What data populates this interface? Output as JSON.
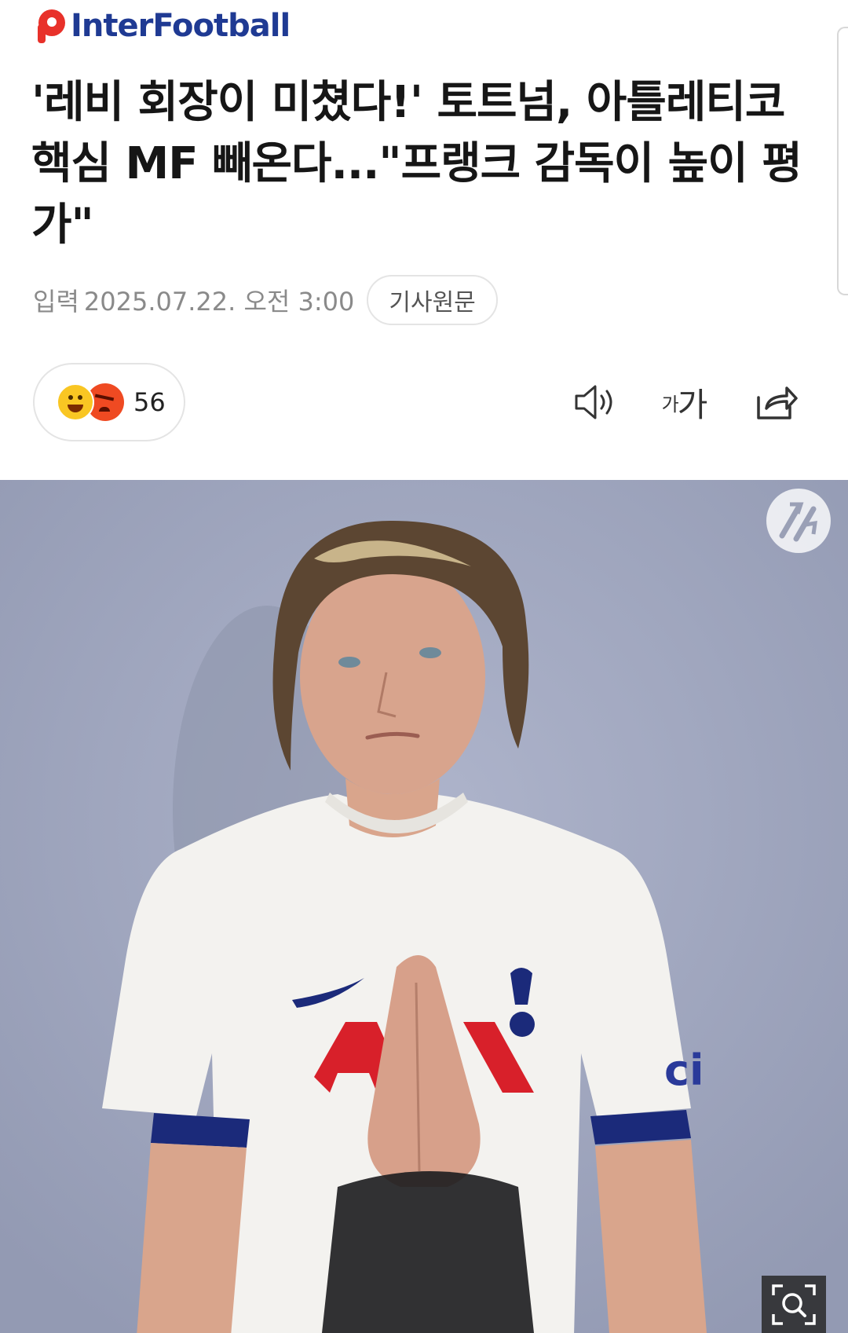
{
  "header": {
    "logo_text": "InterFootball",
    "brand_color": "#1f3a93",
    "accent_color": "#e8312a"
  },
  "article": {
    "headline": "'레비 회장이 미쳤다!' 토트넘, 아틀레티코 핵심 MF 빼온다...\"프랭크 감독이 높이 평가\"",
    "published_label": "입력",
    "published_date": "2025.07.22. 오전 3:00",
    "original_article_button": "기사원문"
  },
  "reactions": {
    "count": "56",
    "emojis": [
      "happy-face-icon",
      "angry-face-icon"
    ]
  },
  "toolbar": {
    "speaker_icon": "speaker-icon",
    "font_small_glyph": "가",
    "font_large_glyph": "가",
    "share_icon": "share-icon"
  },
  "photo": {
    "watermark_icon": "interfootball-watermark-icon",
    "zoom_icon": "zoom-search-icon"
  }
}
